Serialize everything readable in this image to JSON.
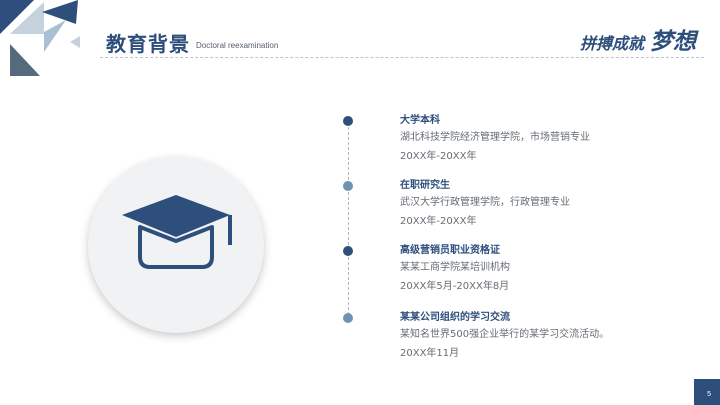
{
  "header": {
    "title": "教育背景",
    "subtitle": "Doctoral reexamination",
    "slogan_small": "拼搏成就",
    "slogan_large": "梦想"
  },
  "timeline": [
    {
      "title": "大学本科",
      "line1": "湖北科技学院经济管理学院，市场营销专业",
      "line2": "20XX年-20XX年",
      "dot_color": "#2e4f7c"
    },
    {
      "title": "在职研究生",
      "line1": "武汉大学行政管理学院，行政管理专业",
      "line2": "20XX年-20XX年",
      "dot_color": "#6f93b3"
    },
    {
      "title": "高级营销员职业资格证",
      "line1": "某某工商学院某培训机构",
      "line2": "20XX年5月-20XX年8月",
      "dot_color": "#2e4f7c"
    },
    {
      "title": "某某公司组织的学习交流",
      "line1": "某知名世界500强企业举行的某学习交流活动。",
      "line2": "20XX年11月",
      "dot_color": "#6f93b3"
    }
  ],
  "page_number": "5",
  "icons": {
    "graduation": "graduation-cap-icon"
  },
  "colors": {
    "primary": "#2e4f7c",
    "accent": "#6f93b3"
  }
}
